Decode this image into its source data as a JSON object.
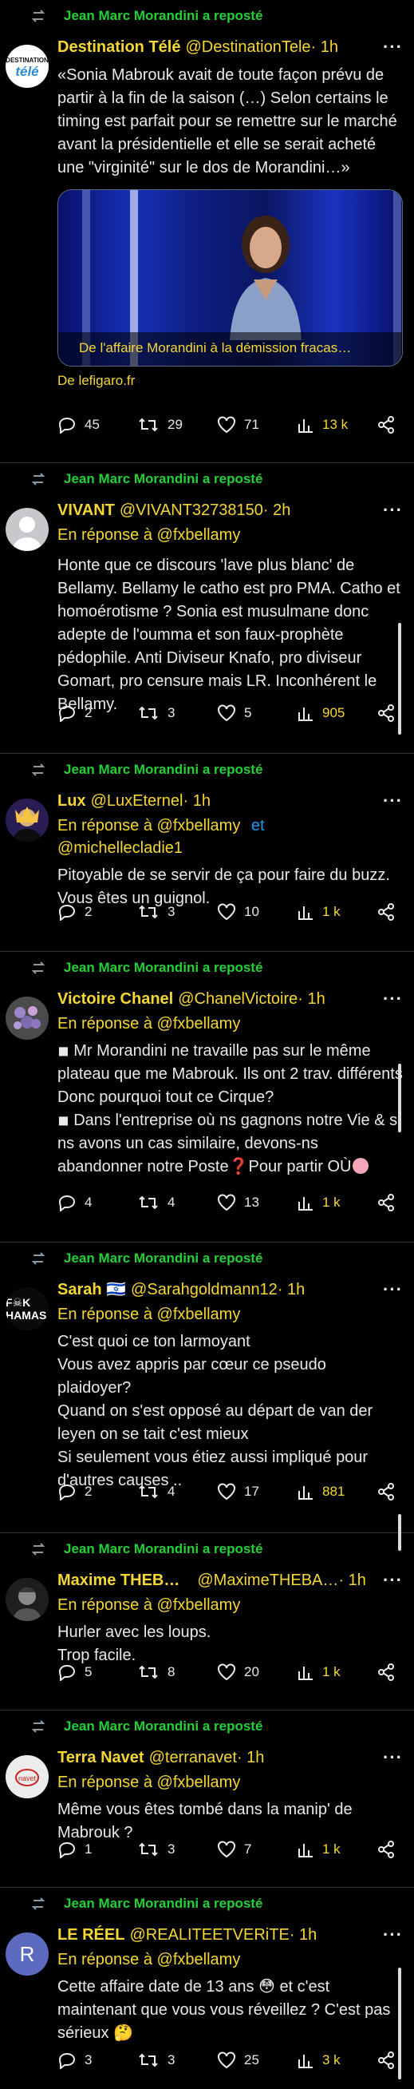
{
  "repost_label": "Jean Marc Morandini a reposté",
  "more_label": "···",
  "reply_prefix": "En réponse à",
  "colors": {
    "accent_yellow": "#f5d733",
    "repost_green": "#21d136",
    "link_blue": "#1d9bf0",
    "background": "#000000"
  },
  "tweets": [
    {
      "avatar_text": "DESTINATION télé",
      "name": "Destination Télé",
      "handle": "@DestinationTele",
      "time": " · 1h",
      "text": "«Sonia Mabrouk avait de toute façon prévu de partir à la fin de la saison (…) Selon certains le timing est parfait pour se remettre sur le marché avant la présidentielle et elle se serait acheté une \"virginité\" sur le dos de Morandini…»",
      "media_caption": "De l'affaire Morandini à la démission fracas…",
      "source": "De lefigaro.fr",
      "replies": "45",
      "reposts": "29",
      "likes": "71",
      "views": "13 k"
    },
    {
      "name": "VIVANT",
      "handle": "@VIVANT32738150",
      "time": " · 2h",
      "reply_to": "@fxbellamy",
      "text": "Honte que ce discours 'lave plus blanc' de Bellamy. Bellamy le catho est pro PMA. Catho et homoérotisme ? Sonia est musulmane donc adepte de l'oumma et son faux-prophète pédophile. Anti Diviseur Knafo, pro diviseur Gomart, pro censure mais LR. Inconhérent le Bellamy.",
      "replies": "2",
      "reposts": "3",
      "likes": "5",
      "views": "905"
    },
    {
      "name": "Lux",
      "handle": "@LuxEternel",
      "time": " · 1h",
      "reply_to": "@fxbellamy",
      "reply_and": "et",
      "reply_to2": "@michellecladie1",
      "text": "Pitoyable de se servir de ça pour faire du buzz. Vous êtes un guignol.",
      "replies": "2",
      "reposts": "3",
      "likes": "10",
      "views": "1 k"
    },
    {
      "name": "Victoire Chanel",
      "handle": "@ChanelVictoire",
      "time": " · 1h",
      "reply_to": "@fxbellamy",
      "text": "◾ Mr Morandini ne travaille pas sur le même plateau que me Mabrouk. Ils ont 2 trav. différents\nDonc pourquoi tout ce Cirque?\n◾ Dans l'entreprise où ns gagnons notre Vie & si ns avons un cas similaire, devons-ns abandonner notre Poste❓Pour partir OÙ",
      "replies": "4",
      "reposts": "4",
      "likes": "13",
      "views": "1 k"
    },
    {
      "avatar_text": "F☠K HAMAS",
      "name": "Sarah 🇮🇱",
      "handle": "@Sarahgoldmann12",
      "time": " · 1h",
      "reply_to": "@fxbellamy",
      "text": "C'est quoi ce ton larmoyant\nVous avez appris par cœur ce pseudo plaidoyer?\nQuand on s'est opposé au départ de van der leyen on se tait c'est mieux\nSi seulement vous étiez aussi impliqué pour d'autres causes ..",
      "replies": "2",
      "reposts": "4",
      "likes": "17",
      "views": "881"
    },
    {
      "name": "Maxime THEB…",
      "handle": "@MaximeTHEBA…",
      "time": " · 1h",
      "reply_to": "@fxbellamy",
      "text": "Hurler avec les loups.\nTrop facile.",
      "replies": "5",
      "reposts": "8",
      "likes": "20",
      "views": "1 k"
    },
    {
      "name": "Terra Navet",
      "handle": "@terranavet",
      "time": " · 1h",
      "reply_to": "@fxbellamy",
      "text": "Même vous êtes tombé dans la manip' de Mabrouk ?",
      "replies": "1",
      "reposts": "3",
      "likes": "7",
      "views": "1 k"
    },
    {
      "avatar_text": "R",
      "name": "LE RÉEL",
      "handle": "@REALITEETVERiTE",
      "time": " · 1h",
      "reply_to": "@fxbellamy",
      "text": "Cette affaire date de 13 ans 😳 et c'est maintenant que vous vous réveillez ? C'est pas sérieux 🤔",
      "replies": "3",
      "reposts": "3",
      "likes": "25",
      "views": "3 k"
    }
  ]
}
